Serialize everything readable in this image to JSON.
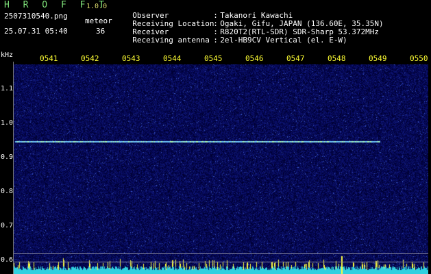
{
  "header": {
    "app_title": "H R O F F T",
    "app_version": "1.0.0",
    "file_name": "2507310540.png",
    "meteor_label": "meteor",
    "datetime": "25.07.31 05:40",
    "meteor_count": "36",
    "info": [
      {
        "label": "Observer",
        "sep": ":",
        "value": "Takanori Kawachi"
      },
      {
        "label": "Receiving Location",
        "sep": ":",
        "value": "Ogaki, Gifu, JAPAN (136.60E, 35.35N)"
      },
      {
        "label": "Receiver",
        "sep": ":",
        "value": "R820T2(RTL-SDR) SDR-Sharp 53.372MHz"
      },
      {
        "label": "Receiving antenna",
        "sep": ":",
        "value": "2el-HB9CV Vertical (el. E-W)"
      }
    ]
  },
  "spectrogram": {
    "y_unit": "kHz",
    "time_ticks": [
      "0541",
      "0542",
      "0543",
      "0544",
      "0545",
      "0546",
      "0547",
      "0548",
      "0549",
      "0550"
    ],
    "freq_ticks": [
      "1.1",
      "1.0",
      "0.9",
      "0.8",
      "0.7",
      "0.6"
    ],
    "colors": {
      "background": "#04063a",
      "carrier": "#7fd0ff",
      "baseline": "#30d0e0",
      "spike": "#ffff40"
    }
  }
}
